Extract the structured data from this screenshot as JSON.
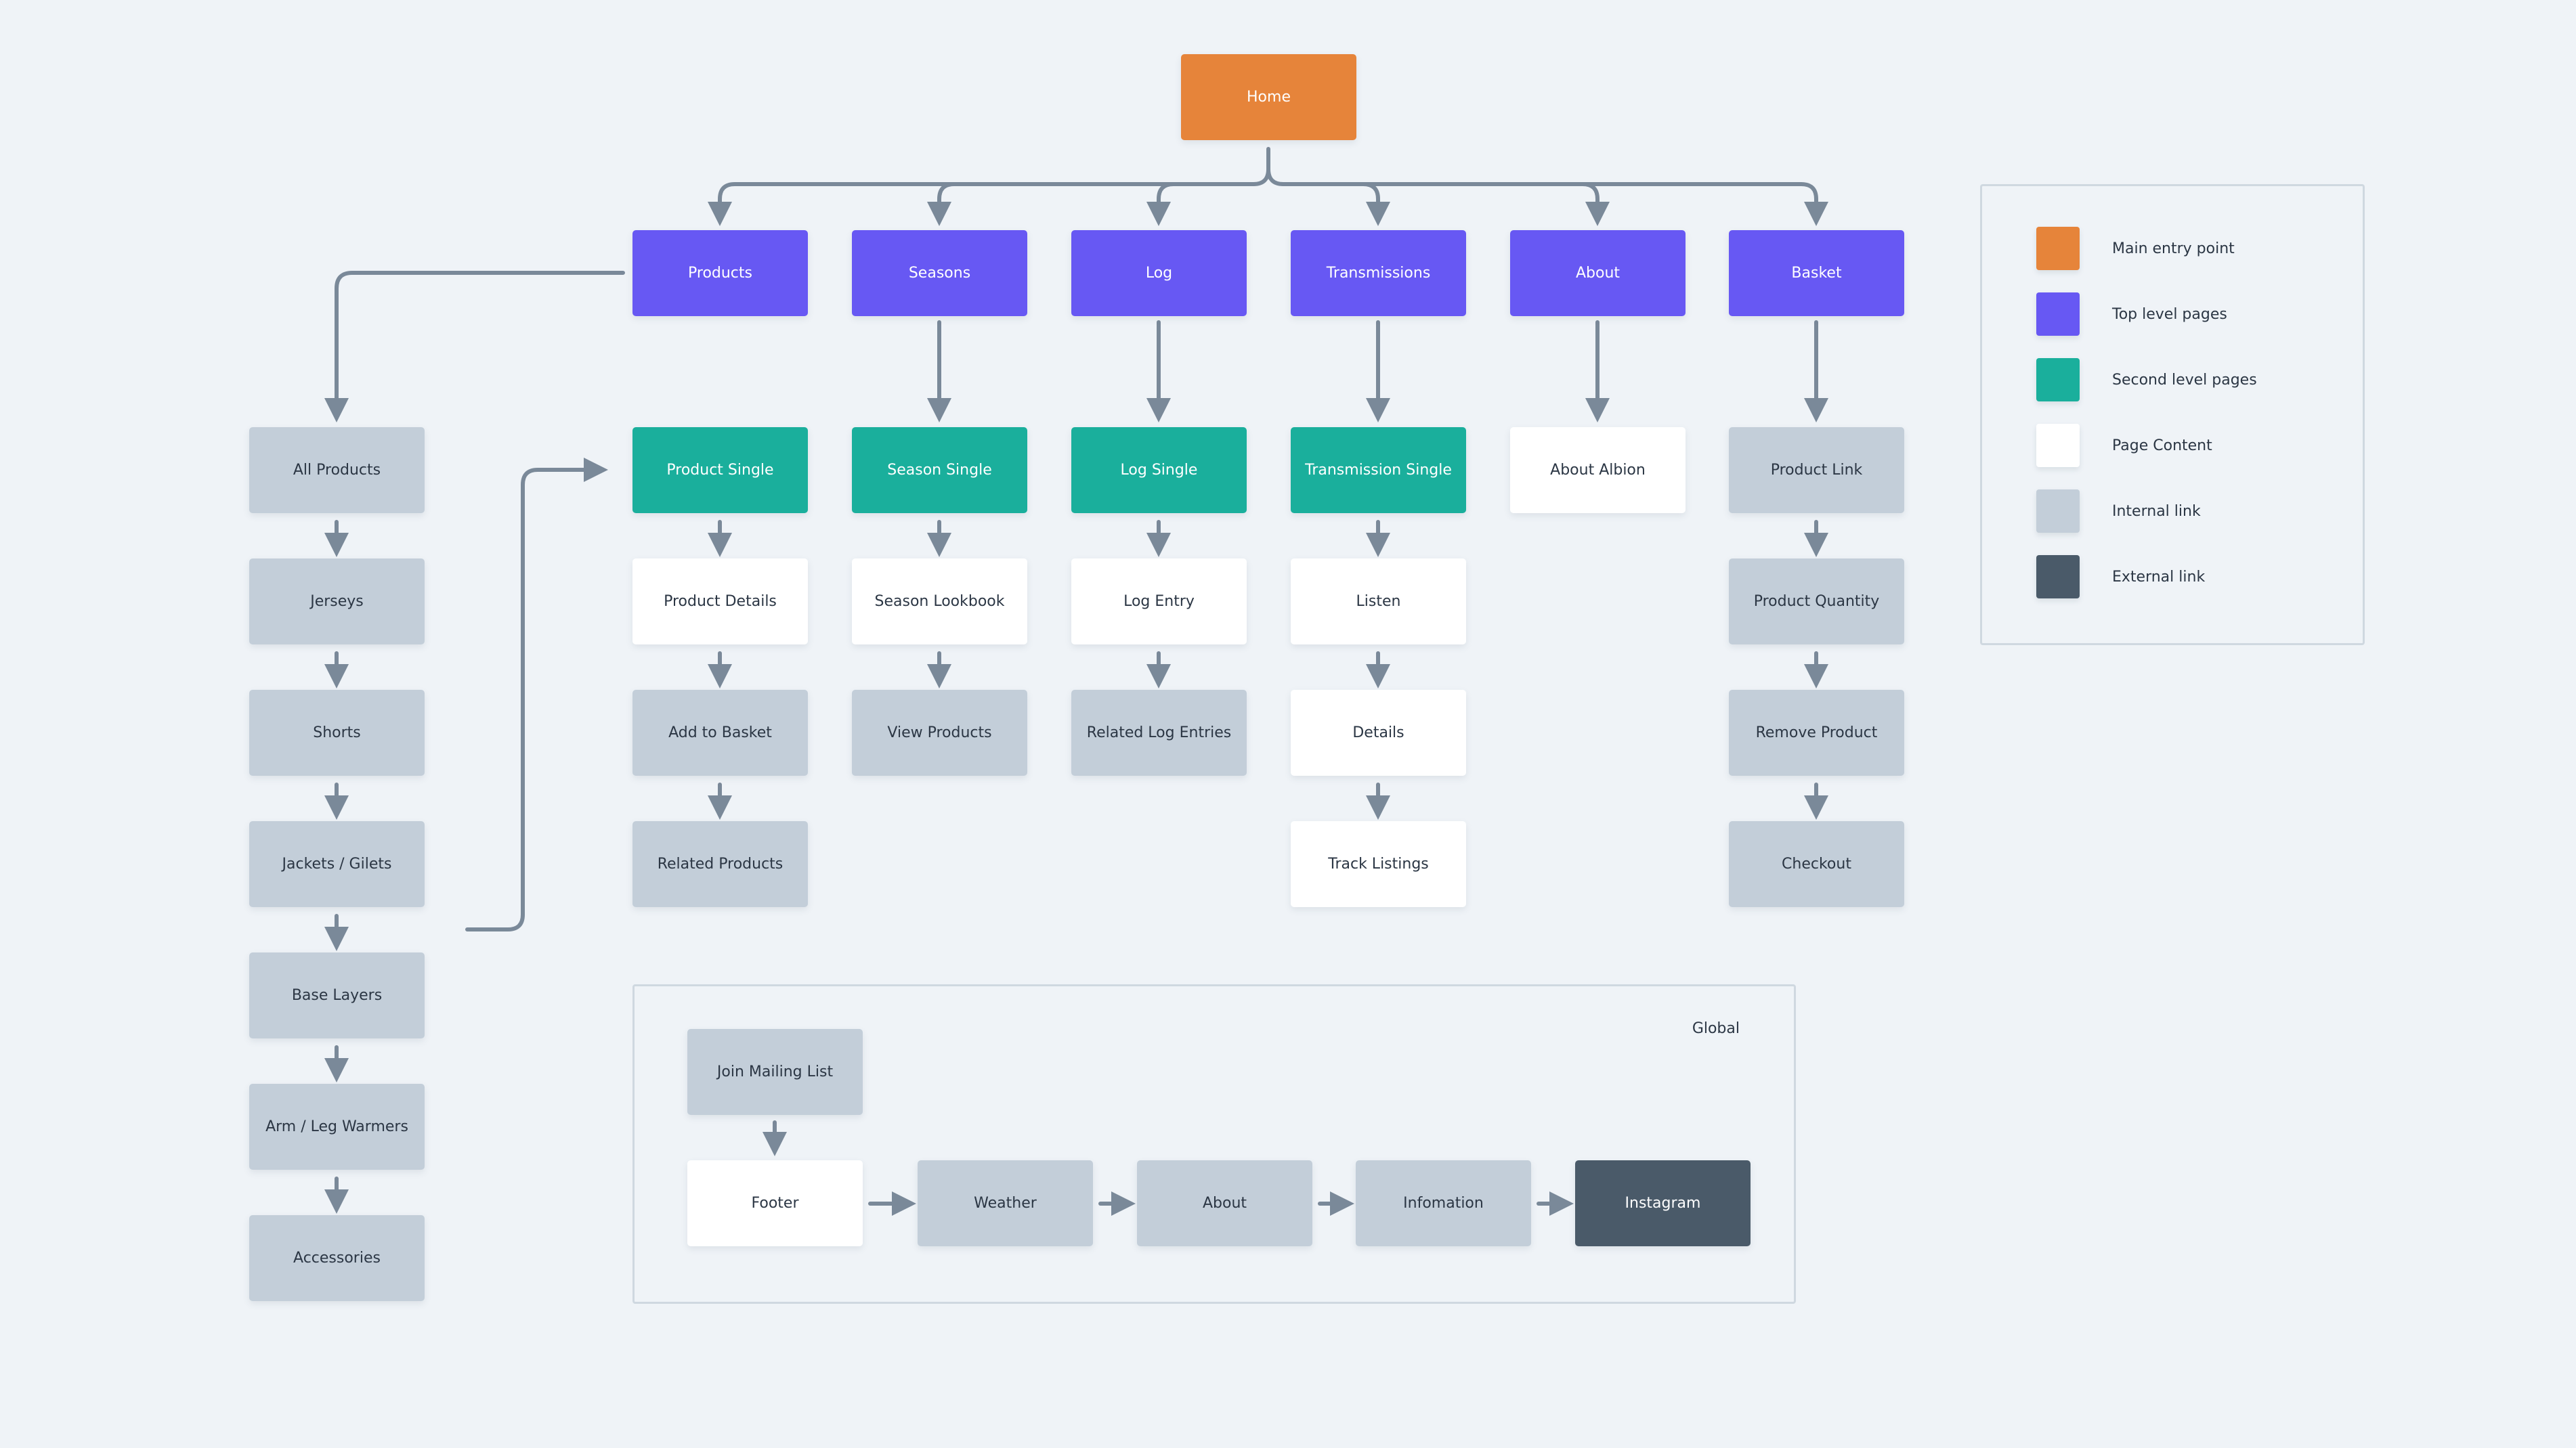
{
  "colors": {
    "main_entry": "#e6843a",
    "top_level": "#6758f3",
    "second_level": "#1aaf9c",
    "page_content": "#ffffff",
    "internal_link": "#c3ced9",
    "external_link": "#4a5a69",
    "connector": "#7a8999"
  },
  "home": {
    "label": "Home"
  },
  "top_level": [
    {
      "label": "Products"
    },
    {
      "label": "Seasons"
    },
    {
      "label": "Log"
    },
    {
      "label": "Transmissions"
    },
    {
      "label": "About"
    },
    {
      "label": "Basket"
    }
  ],
  "products_list": [
    {
      "label": "All Products"
    },
    {
      "label": "Jerseys"
    },
    {
      "label": "Shorts"
    },
    {
      "label": "Jackets / Gilets"
    },
    {
      "label": "Base Layers"
    },
    {
      "label": "Arm / Leg Warmers"
    },
    {
      "label": "Accessories"
    }
  ],
  "columns": {
    "products": [
      {
        "label": "Product Single",
        "type": "second"
      },
      {
        "label": "Product Details",
        "type": "content"
      },
      {
        "label": "Add to Basket",
        "type": "internal"
      },
      {
        "label": "Related Products",
        "type": "internal"
      }
    ],
    "seasons": [
      {
        "label": "Season Single",
        "type": "second"
      },
      {
        "label": "Season Lookbook",
        "type": "content"
      },
      {
        "label": "View Products",
        "type": "internal"
      }
    ],
    "log": [
      {
        "label": "Log Single",
        "type": "second"
      },
      {
        "label": "Log Entry",
        "type": "content"
      },
      {
        "label": "Related Log Entries",
        "type": "internal"
      }
    ],
    "transmissions": [
      {
        "label": "Transmission Single",
        "type": "second"
      },
      {
        "label": "Listen",
        "type": "content"
      },
      {
        "label": "Details",
        "type": "content"
      },
      {
        "label": "Track Listings",
        "type": "content"
      }
    ],
    "about": [
      {
        "label": "About Albion",
        "type": "content"
      }
    ],
    "basket": [
      {
        "label": "Product Link",
        "type": "internal"
      },
      {
        "label": "Product Quantity",
        "type": "internal"
      },
      {
        "label": "Remove Product",
        "type": "internal"
      },
      {
        "label": "Checkout",
        "type": "internal"
      }
    ]
  },
  "global": {
    "title": "Global",
    "join_mailing_list": "Join Mailing List",
    "chain": [
      {
        "label": "Footer",
        "type": "content"
      },
      {
        "label": "Weather",
        "type": "internal"
      },
      {
        "label": "About",
        "type": "internal"
      },
      {
        "label": "Infomation",
        "type": "internal"
      },
      {
        "label": "Instagram",
        "type": "external"
      }
    ]
  },
  "legend": [
    {
      "label": "Main entry point",
      "type": "entry"
    },
    {
      "label": "Top level pages",
      "type": "top"
    },
    {
      "label": "Second level pages",
      "type": "second"
    },
    {
      "label": "Page Content",
      "type": "content"
    },
    {
      "label": "Internal link",
      "type": "internal"
    },
    {
      "label": "External link",
      "type": "external"
    }
  ]
}
